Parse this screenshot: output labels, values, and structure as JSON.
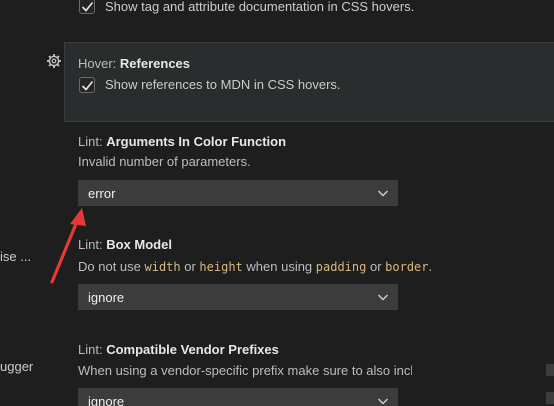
{
  "sidebar": {
    "fragment_1": "ise ...",
    "fragment_2": "ugger"
  },
  "settings": [
    {
      "id": "show-tag-docs",
      "checkbox_label": "Show tag and attribute documentation in CSS hovers.",
      "checked": true
    },
    {
      "id": "hover-references",
      "category": "Hover:",
      "title": "References",
      "checkbox_label": "Show references to MDN in CSS hovers.",
      "checked": true
    },
    {
      "id": "lint-args-color",
      "category": "Lint:",
      "title": "Arguments In Color Function",
      "description": "Invalid number of parameters.",
      "value": "error"
    },
    {
      "id": "lint-box-model",
      "category": "Lint:",
      "title": "Box Model",
      "description_parts": [
        "Do not use ",
        "width",
        " or ",
        "height",
        " when using ",
        "padding",
        " or ",
        "border",
        "."
      ],
      "value": "ignore"
    },
    {
      "id": "lint-vendor-prefixes",
      "category": "Lint:",
      "title": "Compatible Vendor Prefixes",
      "description": "When using a vendor-specific prefix make sure to also inclu",
      "value": "ignore"
    }
  ],
  "colors": {
    "background": "#1e1e1e",
    "dropdown": "#3c3c3c",
    "code": "#d7ba7d",
    "annotation_arrow": "#e53935"
  },
  "icons": [
    "gear-icon",
    "check-icon",
    "chevron-down-icon"
  ]
}
